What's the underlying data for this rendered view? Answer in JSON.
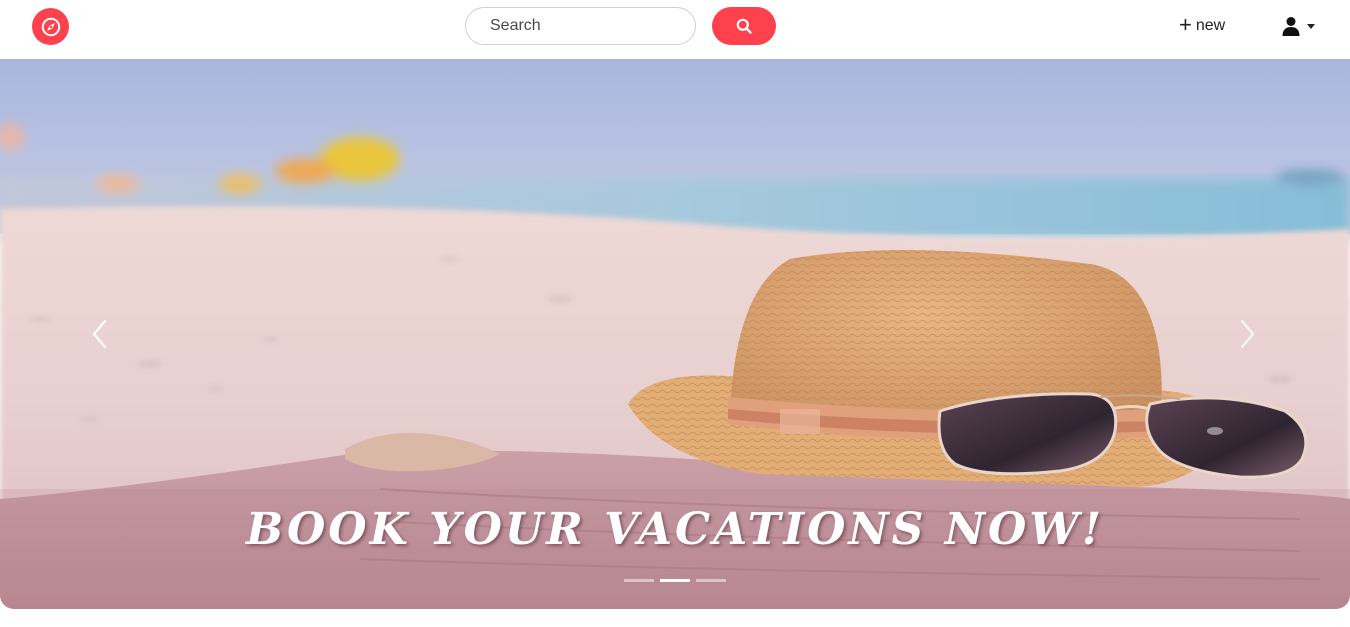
{
  "navbar": {
    "logo_icon": "compass-icon",
    "brand_color": "#fe424d",
    "search": {
      "placeholder": "Search",
      "value": "",
      "button_icon": "search-icon"
    },
    "new_link": {
      "icon": "plus-icon",
      "label": "new"
    },
    "user_menu": {
      "icon": "user-icon",
      "dropdown_icon": "caret-down-icon"
    }
  },
  "carousel": {
    "caption": "BOOK YOUR VACATIONS NOW!",
    "prev_icon": "chevron-left-icon",
    "next_icon": "chevron-right-icon",
    "slide_count": 3,
    "active_slide": 2,
    "scene": "beach-straw-hat-sunglasses-towel"
  }
}
